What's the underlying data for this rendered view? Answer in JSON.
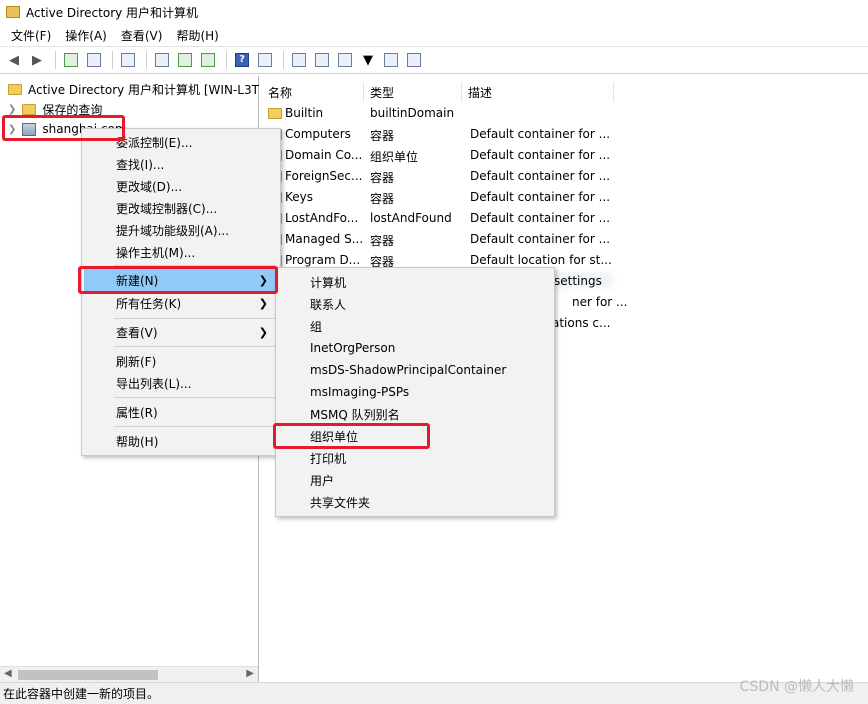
{
  "window": {
    "title": "Active Directory 用户和计算机"
  },
  "menu": [
    "文件(F)",
    "操作(A)",
    "查看(V)",
    "帮助(H)"
  ],
  "tree": {
    "root": "Active Directory 用户和计算机 [WIN-L3T",
    "saved_queries": "保存的查询",
    "domain": "shanghai.com"
  },
  "columns": [
    "名称",
    "类型",
    "描述"
  ],
  "rows": [
    {
      "name": "Builtin",
      "type": "builtinDomain",
      "desc": ""
    },
    {
      "name": "Computers",
      "type": "容器",
      "desc": "Default container for ..."
    },
    {
      "name": "Domain Co...",
      "type": "组织单位",
      "desc": "Default container for ..."
    },
    {
      "name": "ForeignSec...",
      "type": "容器",
      "desc": "Default container for ..."
    },
    {
      "name": "Keys",
      "type": "容器",
      "desc": "Default container for ..."
    },
    {
      "name": "LostAndFo...",
      "type": "lostAndFound",
      "desc": "Default container for ..."
    },
    {
      "name": "Managed S...",
      "type": "容器",
      "desc": "Default container for ..."
    },
    {
      "name": "Program D...",
      "type": "容器",
      "desc": "Default location for st..."
    }
  ],
  "partial_desc": [
    "settings",
    "ner for ...",
    "ations c..."
  ],
  "context_menu": {
    "items": [
      "委派控制(E)...",
      "查找(I)...",
      "更改域(D)...",
      "更改域控制器(C)...",
      "提升域功能级别(A)...",
      "操作主机(M)...",
      "新建(N)",
      "所有任务(K)",
      "查看(V)",
      "刷新(F)",
      "导出列表(L)...",
      "属性(R)",
      "帮助(H)"
    ]
  },
  "submenu": {
    "items": [
      "计算机",
      "联系人",
      "组",
      "InetOrgPerson",
      "msDS-ShadowPrincipalContainer",
      "msImaging-PSPs",
      "MSMQ 队列别名",
      "组织单位",
      "打印机",
      "用户",
      "共享文件夹"
    ]
  },
  "status_text": "在此容器中创建一新的项目。",
  "watermark": "CSDN @懒人大懒",
  "colors": {
    "highlight": "#91c9f7",
    "annotation": "#e8192a"
  }
}
